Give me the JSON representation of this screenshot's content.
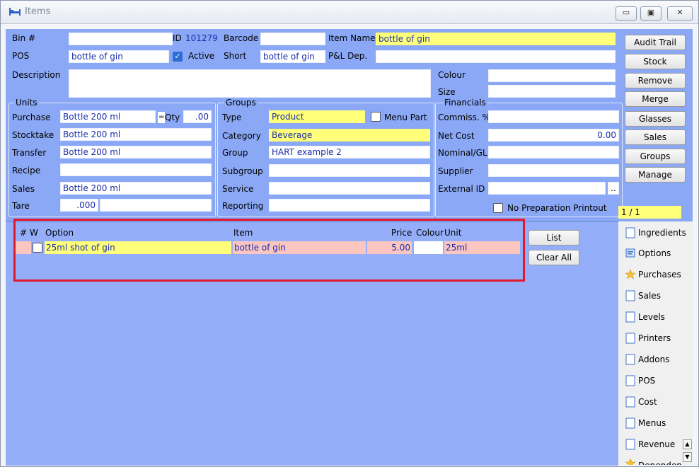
{
  "window": {
    "title": "Items",
    "controls": {
      "minimize": "▭",
      "restore": "▣",
      "close": "✕"
    }
  },
  "top": {
    "bin_label": "Bin #",
    "bin_value": "",
    "id_label": "ID",
    "id_value": "101279",
    "barcode_label": "Barcode",
    "barcode_value": "",
    "item_name_label": "Item Name",
    "item_name_value": "bottle of gin",
    "pos_label": "POS",
    "pos_value": "bottle of gin",
    "active_label": "Active",
    "active_checked": true,
    "short_label": "Short",
    "short_value": "bottle of gin",
    "pl_dep_label": "P&L Dep.",
    "pl_dep_value": "",
    "description_label": "Description",
    "description_value": "",
    "colour_label": "Colour",
    "colour_value": "",
    "size_label": "Size",
    "size_value": ""
  },
  "units": {
    "title": "Units",
    "purchase_label": "Purchase",
    "purchase_value": "Bottle 200 ml",
    "eq": "=",
    "qty_label": "Qty",
    "qty_value": ".00",
    "stocktake_label": "Stocktake",
    "stocktake_value": "Bottle 200 ml",
    "transfer_label": "Transfer",
    "transfer_value": "Bottle 200 ml",
    "recipe_label": "Recipe",
    "recipe_value": "",
    "sales_label": "Sales",
    "sales_value": "Bottle 200 ml",
    "tare_label": "Tare",
    "tare_value": ".000"
  },
  "groups": {
    "title": "Groups",
    "type_label": "Type",
    "type_value": "Product",
    "menu_part_label": "Menu Part",
    "category_label": "Category",
    "category_value": "Beverage",
    "group_label": "Group",
    "group_value": "HART example 2",
    "subgroup_label": "Subgroup",
    "subgroup_value": "",
    "service_label": "Service",
    "service_value": "",
    "reporting_label": "Reporting",
    "reporting_value": ""
  },
  "financials": {
    "title": "Financials",
    "commiss_label": "Commiss. %",
    "commiss_value": "",
    "net_cost_label": "Net Cost",
    "net_cost_value": "0.00",
    "nominal_label": "Nominal/GL",
    "nominal_value": "",
    "supplier_label": "Supplier",
    "supplier_value": "",
    "external_id_label": "External ID",
    "external_id_value": "",
    "ellipsis": "..",
    "no_prep_label": "No Preparation Printout",
    "pager": "1 / 1"
  },
  "right_buttons": [
    "Audit Trail",
    "Stock",
    "Remove",
    "Merge",
    "Glasses",
    "Sales",
    "Groups",
    "Manage"
  ],
  "options_table": {
    "headers": {
      "num": "#",
      "w": "W",
      "option": "Option",
      "item": "Item",
      "price": "Price",
      "colour": "Colour",
      "unit": "Unit"
    },
    "rows": [
      {
        "option": "25ml shot of gin",
        "item": "bottle of gin",
        "price": "5.00",
        "colour": "",
        "unit": "25ml"
      }
    ],
    "list_button": "List",
    "clear_all_button": "Clear All"
  },
  "tabs": [
    "Ingredients",
    "Options",
    "Purchases",
    "Sales",
    "Levels",
    "Printers",
    "Addons",
    "POS",
    "Cost",
    "Menus",
    "Revenue",
    "Dependen"
  ],
  "colors": {
    "field_yellow": "#ffff7a",
    "row_pink": "#fbc6c0",
    "panel_blue": "#8aa8f5",
    "highlight_red": "#e3172a"
  }
}
